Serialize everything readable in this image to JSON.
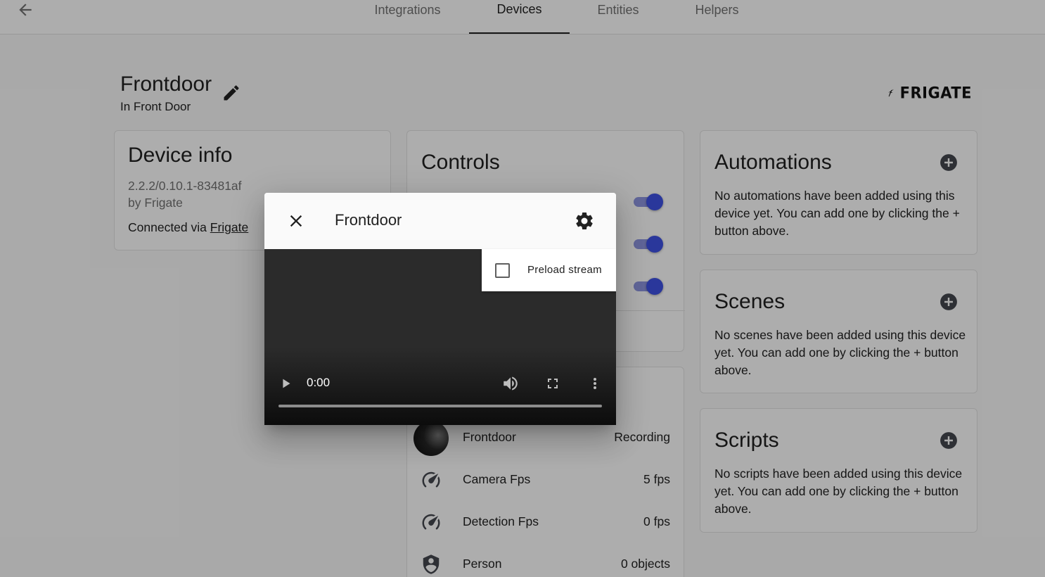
{
  "nav": {
    "back_icon": "arrow-left-icon",
    "tabs": [
      {
        "label": "Integrations",
        "active": false
      },
      {
        "label": "Devices",
        "active": true
      },
      {
        "label": "Entities",
        "active": false
      },
      {
        "label": "Helpers",
        "active": false
      }
    ]
  },
  "device": {
    "name": "Frontdoor",
    "area": "In Front Door",
    "edit_icon": "pencil-icon",
    "brand_logo": "FRIGATE"
  },
  "device_info": {
    "title": "Device info",
    "version": "2.2.2/0.10.1-83481af",
    "manufacturer": "by Frigate",
    "connected_prefix": "Connected via",
    "connected_link": "Frigate"
  },
  "controls": {
    "title": "Controls",
    "toggles": [
      true,
      true,
      true
    ]
  },
  "sensors": [
    {
      "name": "Frontdoor",
      "state": "Recording",
      "icon": "camera-thumbnail"
    },
    {
      "name": "Camera Fps",
      "state": "5 fps",
      "icon": "speedometer-icon"
    },
    {
      "name": "Detection Fps",
      "state": "0 fps",
      "icon": "speedometer-icon"
    },
    {
      "name": "Person",
      "state": "0 objects",
      "icon": "shield-account-icon"
    }
  ],
  "automations": {
    "title": "Automations",
    "text": "No automations have been added using this device yet. You can add one by clicking the + button above."
  },
  "scenes": {
    "title": "Scenes",
    "text": "No scenes have been added using this device yet. You can add one by clicking the + button above."
  },
  "scripts": {
    "title": "Scripts",
    "text": "No scripts have been added using this device yet. You can add one by clicking the + button above."
  },
  "dialog": {
    "title": "Frontdoor",
    "close_icon": "close-icon",
    "settings_icon": "cog-icon",
    "preload_label": "Preload stream",
    "preload_checked": false,
    "video_time": "0:00"
  }
}
